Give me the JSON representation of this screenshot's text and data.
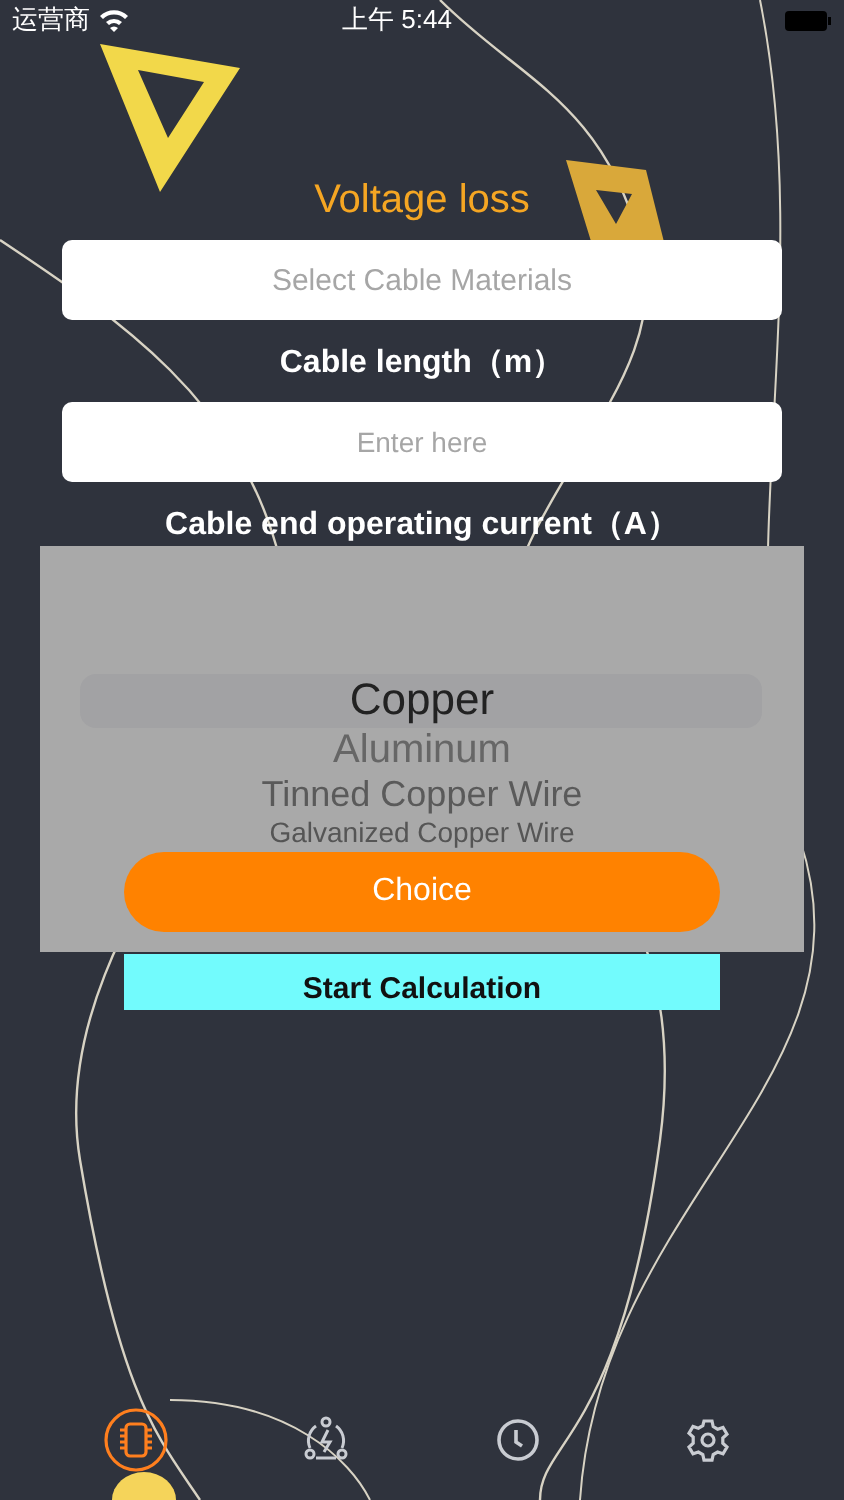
{
  "status_bar": {
    "carrier": "运营商",
    "time": "上午 5:44"
  },
  "title": "Voltage loss",
  "material_field": {
    "placeholder": "Select Cable Materials"
  },
  "length_label": "Cable length（m）",
  "length_field": {
    "placeholder": "Enter here"
  },
  "current_label": "Cable end operating current（A）",
  "start_button": "Start Calculation",
  "picker": {
    "options": [
      {
        "label": "Copper",
        "selected": true
      },
      {
        "label": "Aluminum",
        "selected": false
      },
      {
        "label": "Tinned Copper Wire",
        "selected": false
      },
      {
        "label": "Galvanized Copper Wire",
        "selected": false
      }
    ],
    "button": "Choice"
  },
  "tabs": [
    {
      "kind": "chip",
      "selected": true
    },
    {
      "kind": "power",
      "selected": false
    },
    {
      "kind": "clock",
      "selected": false
    },
    {
      "kind": "gear",
      "selected": false
    }
  ]
}
